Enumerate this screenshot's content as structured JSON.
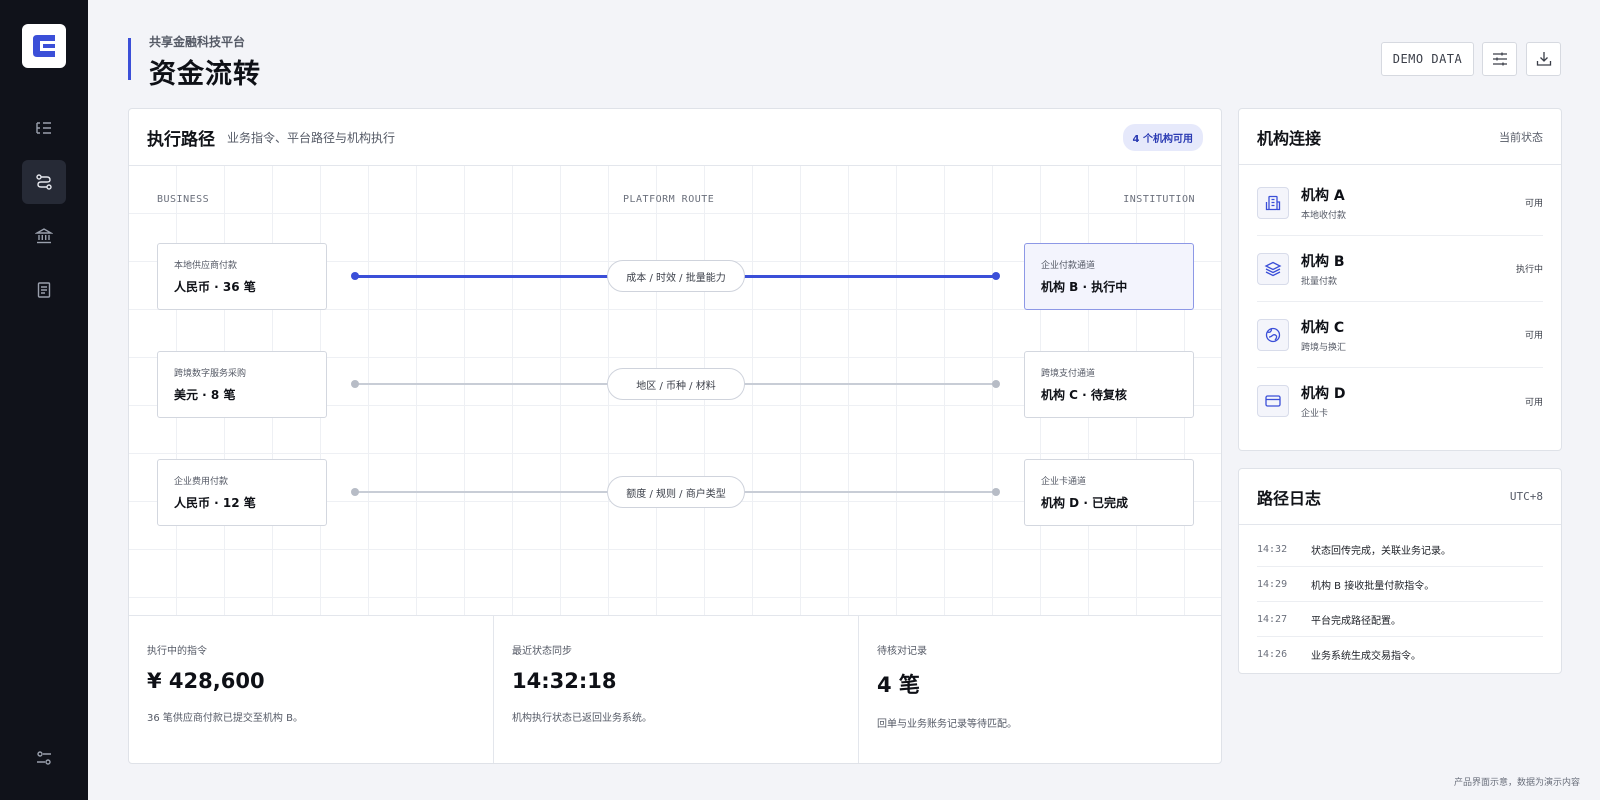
{
  "sidebar": {
    "items": [
      {
        "name": "list-icon"
      },
      {
        "name": "route-icon",
        "active": true
      },
      {
        "name": "bank-icon"
      },
      {
        "name": "document-icon"
      }
    ],
    "bottom_icon": "sliders-icon"
  },
  "header": {
    "subtitle": "共享金融科技平台",
    "title": "资金流转",
    "demo_label": "DEMO DATA"
  },
  "main": {
    "title": "执行路径",
    "description": "业务指令、平台路径与机构执行",
    "badge": "4 个机构可用",
    "columns": [
      "BUSINESS",
      "PLATFORM ROUTE",
      "INSTITUTION"
    ],
    "routes": [
      {
        "source_label": "本地供应商付款",
        "source_value": "人民币 · 36 笔",
        "route": "成本 / 时效 / 批量能力",
        "target_label": "企业付款通道",
        "target_value": "机构 B · 执行中",
        "active": true
      },
      {
        "source_label": "跨境数字服务采购",
        "source_value": "美元 · 8 笔",
        "route": "地区 / 币种 / 材料",
        "target_label": "跨境支付通道",
        "target_value": "机构 C · 待复核",
        "active": false
      },
      {
        "source_label": "企业费用付款",
        "source_value": "人民币 · 12 笔",
        "route": "额度 / 规则 / 商户类型",
        "target_label": "企业卡通道",
        "target_value": "机构 D · 已完成",
        "active": false
      }
    ],
    "stats": [
      {
        "label": "执行中的指令",
        "value": "¥ 428,600",
        "desc": "36 笔供应商付款已提交至机构 B。"
      },
      {
        "label": "最近状态同步",
        "value": "14:32:18",
        "desc": "机构执行状态已返回业务系统。"
      },
      {
        "label": "待核对记录",
        "value": "4 笔",
        "desc": "回单与业务账务记录等待匹配。"
      }
    ]
  },
  "institutions": {
    "title": "机构连接",
    "status_label": "当前状态",
    "items": [
      {
        "name": "机构 A",
        "sub": "本地收付款",
        "status": "可用",
        "icon": "building-icon"
      },
      {
        "name": "机构 B",
        "sub": "批量付款",
        "status": "执行中",
        "icon": "layers-icon"
      },
      {
        "name": "机构 C",
        "sub": "跨境与换汇",
        "status": "可用",
        "icon": "globe-icon"
      },
      {
        "name": "机构 D",
        "sub": "企业卡",
        "status": "可用",
        "icon": "card-icon"
      }
    ]
  },
  "logs": {
    "title": "路径日志",
    "timezone": "UTC+8",
    "items": [
      {
        "time": "14:32",
        "msg": "状态回传完成，关联业务记录。"
      },
      {
        "time": "14:29",
        "msg": "机构 B 接收批量付款指令。"
      },
      {
        "time": "14:27",
        "msg": "平台完成路径配置。"
      },
      {
        "time": "14:26",
        "msg": "业务系统生成交易指令。"
      }
    ]
  },
  "footer": {
    "note": "产品界面示意，数据为演示内容"
  },
  "colors": {
    "accent": "#3b4fd8",
    "sidebar_bg": "#10121a",
    "page_bg": "#f3f4f8"
  }
}
